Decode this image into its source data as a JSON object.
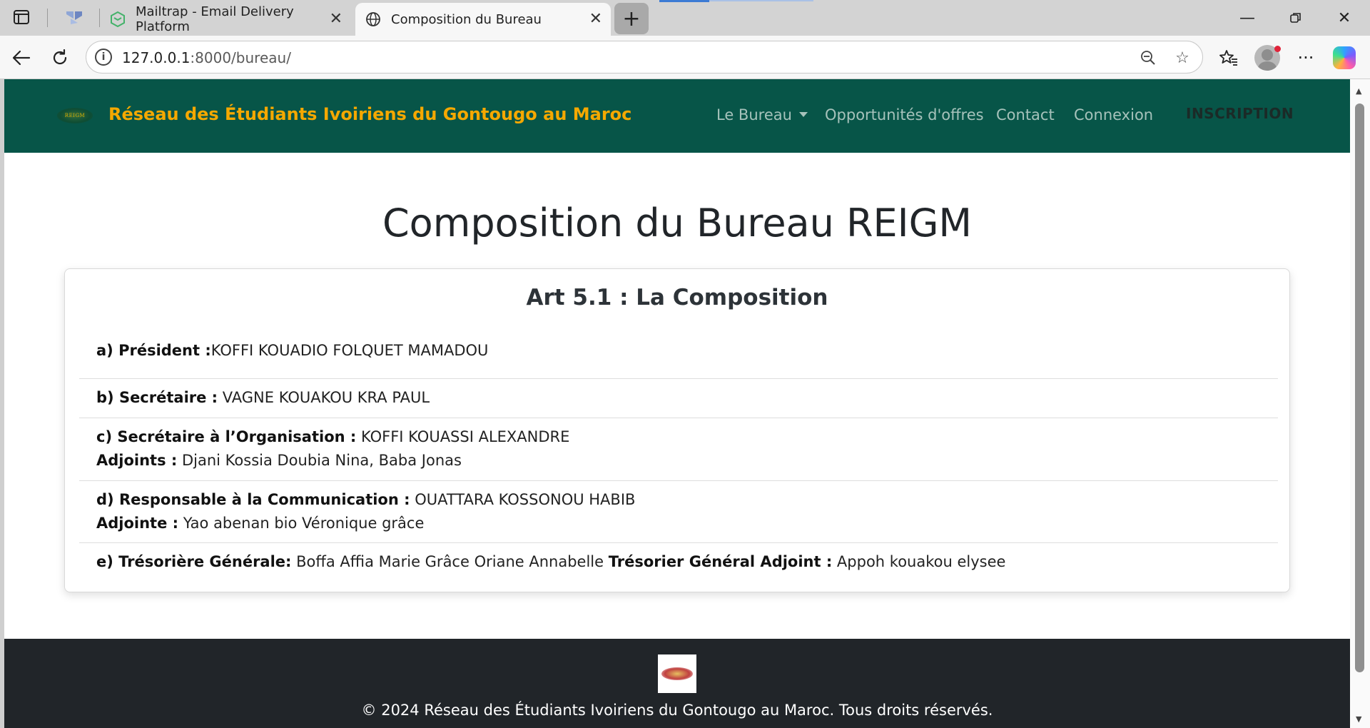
{
  "browser": {
    "tabs": [
      {
        "title": "Mailtrap - Email Delivery Platform",
        "active": false
      },
      {
        "title": "Composition du Bureau",
        "active": true
      }
    ],
    "address": {
      "host": "127.0.0.1",
      "path": ":8000/bureau/"
    },
    "icons": {
      "sidebar": "sidebar-icon",
      "workspaces": "workspaces-icon",
      "back": "back-arrow-icon",
      "reload": "reload-icon",
      "info": "site-info-icon",
      "zoom": "zoom-out-icon",
      "favorite": "star-icon",
      "favorites": "favorites-icon",
      "menu": "more-icon",
      "copilot": "copilot-icon"
    }
  },
  "site": {
    "brand": "Réseau des Étudiants Ivoiriens du Gontougo au Maroc",
    "logo_text": "REIGM",
    "nav": {
      "bureau": "Le Bureau",
      "opportunites": "Opportunités d'offres",
      "contact": "Contact",
      "connexion": "Connexion",
      "inscription": "INSCRIPTION"
    },
    "colors": {
      "navbar": "#075548",
      "brand": "#f5a800",
      "footer": "#212529"
    }
  },
  "main": {
    "title": "Composition du Bureau REIGM",
    "card_title": "Art 5.1 : La Composition",
    "items": [
      {
        "label": "a) Président :",
        "value": "KOFFI KOUADIO FOLQUET MAMADOU"
      },
      {
        "label": "b) Secrétaire :",
        "value": " VAGNE KOUAKOU KRA PAUL"
      },
      {
        "label": "c) Secrétaire à l’Organisation :",
        "value": " KOFFI KOUASSI ALEXANDRE",
        "sub_label": "Adjoints :",
        "sub_value": " Djani Kossia Doubia Nina, Baba Jonas"
      },
      {
        "label": "d) Responsable à la Communication :",
        "value": " OUATTARA KOSSONOU HABIB",
        "sub_label": "Adjointe :",
        "sub_value": " Yao abenan bio Véronique grâce"
      },
      {
        "label": "e) Trésorière Générale:",
        "value": " Boffa Affia Marie Grâce Oriane Annabelle ",
        "label2": "Trésorier Général Adjoint :",
        "value2": " Appoh kouakou elysee"
      }
    ]
  },
  "footer": {
    "text": "© 2024 Réseau des Étudiants Ivoiriens du Gontougo au Maroc. Tous droits réservés."
  }
}
